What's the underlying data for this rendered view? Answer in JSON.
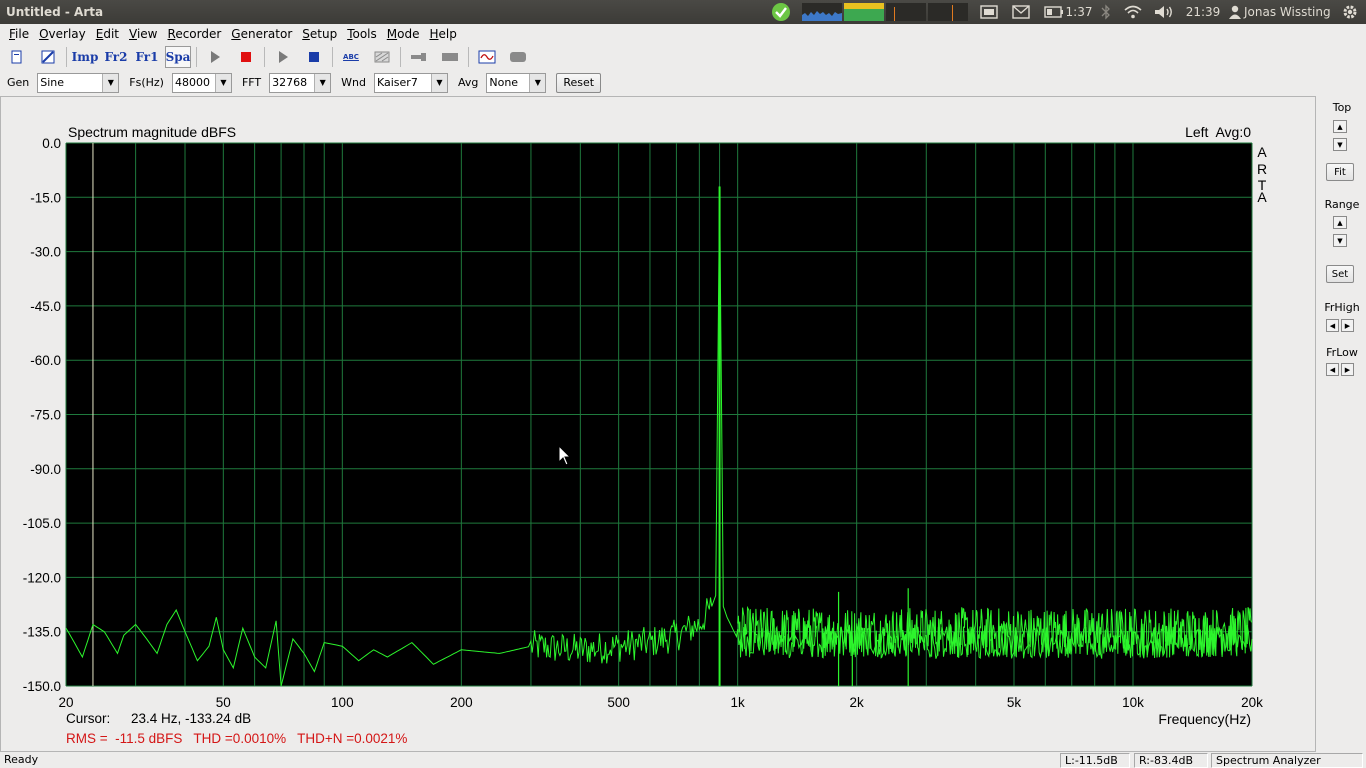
{
  "window": {
    "title": "Untitled - Arta"
  },
  "panel": {
    "battery": "1:37",
    "clock": "21:39",
    "user": "Jonas Wissting"
  },
  "menu": [
    {
      "label": "File",
      "mn": "F",
      "rest": "ile"
    },
    {
      "label": "Overlay",
      "mn": "O",
      "rest": "verlay"
    },
    {
      "label": "Edit",
      "mn": "E",
      "rest": "dit"
    },
    {
      "label": "View",
      "mn": "V",
      "rest": "iew"
    },
    {
      "label": "Recorder",
      "mn": "R",
      "rest": "ecorder"
    },
    {
      "label": "Generator",
      "mn": "G",
      "rest": "enerator"
    },
    {
      "label": "Setup",
      "mn": "S",
      "rest": "etup"
    },
    {
      "label": "Tools",
      "mn": "T",
      "rest": "ools"
    },
    {
      "label": "Mode",
      "mn": "M",
      "rest": "ode"
    },
    {
      "label": "Help",
      "mn": "H",
      "rest": "elp"
    }
  ],
  "toolbar": {
    "imp": "Imp",
    "fr2": "Fr2",
    "fr1": "Fr1",
    "spa": "Spa",
    "abc": "ABC"
  },
  "settings": {
    "gen_label": "Gen",
    "gen_value": "Sine",
    "fs_label": "Fs(Hz)",
    "fs_value": "48000",
    "fft_label": "FFT",
    "fft_value": "32768",
    "wnd_label": "Wnd",
    "wnd_value": "Kaiser7",
    "avg_label": "Avg",
    "avg_value": "None",
    "reset_label": "Reset"
  },
  "chart_data": {
    "type": "line",
    "title": "Spectrum magnitude dBFS",
    "channel_info": "Left  Avg:0",
    "watermark": [
      "A",
      "R",
      "T",
      "A"
    ],
    "xlabel": "Frequency(Hz)",
    "xscale": "log",
    "xlim": [
      20,
      20000
    ],
    "ylim": [
      -150,
      0
    ],
    "y_ticks": [
      "0.0",
      "-15.0",
      "-30.0",
      "-45.0",
      "-60.0",
      "-75.0",
      "-90.0",
      "-105.0",
      "-120.0",
      "-135.0",
      "-150.0"
    ],
    "x_ticks": [
      {
        "v": 20,
        "label": "20"
      },
      {
        "v": 50,
        "label": "50"
      },
      {
        "v": 100,
        "label": "100"
      },
      {
        "v": 200,
        "label": "200"
      },
      {
        "v": 500,
        "label": "500"
      },
      {
        "v": 1000,
        "label": "1k"
      },
      {
        "v": 2000,
        "label": "2k"
      },
      {
        "v": 5000,
        "label": "5k"
      },
      {
        "v": 10000,
        "label": "10k"
      },
      {
        "v": 20000,
        "label": "20k"
      }
    ],
    "grid": true,
    "cursor_marker_hz": 23.4,
    "peaks": [
      {
        "hz": 900,
        "db": -12
      },
      {
        "hz": 1800,
        "db": -124
      },
      {
        "hz": 2700,
        "db": -123
      },
      {
        "hz": 1950,
        "db": -137
      }
    ],
    "noise_floor_db": -138,
    "series": [
      {
        "x": [
          20,
          21,
          22,
          23.4,
          25,
          27,
          28,
          30,
          32,
          34,
          36,
          38,
          40,
          43,
          46,
          48,
          50,
          53,
          56,
          60,
          64,
          68,
          70,
          75,
          80,
          85,
          90,
          100,
          110,
          120,
          130,
          150,
          170,
          200,
          250,
          300,
          400,
          500,
          600,
          700,
          800,
          860,
          880,
          900,
          920,
          940,
          1000,
          1200,
          1500,
          2000,
          3000,
          5000,
          10000,
          20000
        ],
        "y": [
          -134,
          -138,
          -142,
          -133,
          -135,
          -141,
          -136,
          -133,
          -137,
          -141,
          -133,
          -129,
          -135,
          -143,
          -139,
          -131,
          -140,
          -145,
          -134,
          -142,
          -145,
          -132,
          -150,
          -137,
          -141,
          -146,
          -138,
          -139,
          -143,
          -140,
          -142,
          -138,
          -144,
          -140,
          -141,
          -139,
          -140,
          -139,
          -138,
          -136,
          -133,
          -128,
          -125,
          -12,
          -128,
          -131,
          -137,
          -138,
          -138,
          -137,
          -138,
          -138,
          -138,
          -137
        ]
      }
    ]
  },
  "readout": {
    "cursor_label": "Cursor:",
    "cursor_value": "23.4 Hz, -133.24 dB",
    "rms_line": "RMS =  -11.5 dBFS   THD =0.0010%   THD+N =0.0021%"
  },
  "side": {
    "top_label": "Top",
    "fit_label": "Fit",
    "range_label": "Range",
    "set_label": "Set",
    "frhigh_label": "FrHigh",
    "frlow_label": "FrLow"
  },
  "status": {
    "ready": "Ready",
    "left": "L:-11.5dB",
    "right": "R:-83.4dB",
    "mode": "Spectrum Analyzer"
  },
  "colors": {
    "plot_bg": "#000000",
    "grid": "#1f7a3d",
    "trace": "#2cf52c",
    "readout_red": "#d41616",
    "panel_bg": "#3c3b37"
  }
}
